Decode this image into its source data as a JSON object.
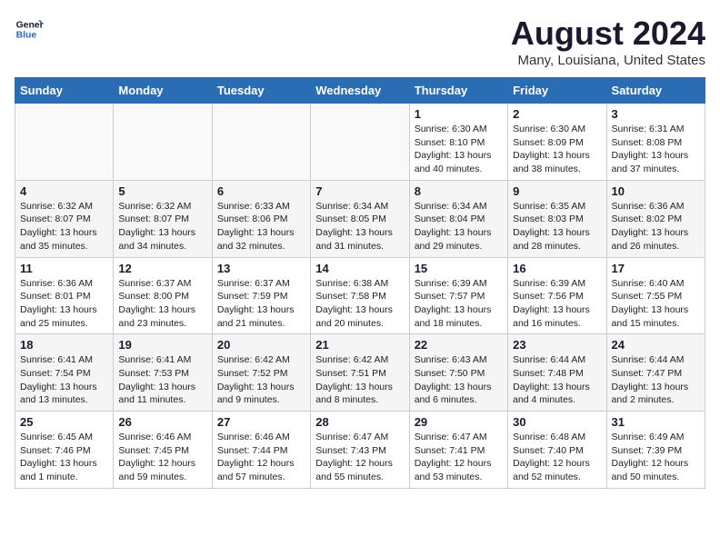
{
  "header": {
    "logo_line1": "General",
    "logo_line2": "Blue",
    "month": "August 2024",
    "location": "Many, Louisiana, United States"
  },
  "weekdays": [
    "Sunday",
    "Monday",
    "Tuesday",
    "Wednesday",
    "Thursday",
    "Friday",
    "Saturday"
  ],
  "weeks": [
    [
      {
        "day": "",
        "info": ""
      },
      {
        "day": "",
        "info": ""
      },
      {
        "day": "",
        "info": ""
      },
      {
        "day": "",
        "info": ""
      },
      {
        "day": "1",
        "info": "Sunrise: 6:30 AM\nSunset: 8:10 PM\nDaylight: 13 hours\nand 40 minutes."
      },
      {
        "day": "2",
        "info": "Sunrise: 6:30 AM\nSunset: 8:09 PM\nDaylight: 13 hours\nand 38 minutes."
      },
      {
        "day": "3",
        "info": "Sunrise: 6:31 AM\nSunset: 8:08 PM\nDaylight: 13 hours\nand 37 minutes."
      }
    ],
    [
      {
        "day": "4",
        "info": "Sunrise: 6:32 AM\nSunset: 8:07 PM\nDaylight: 13 hours\nand 35 minutes."
      },
      {
        "day": "5",
        "info": "Sunrise: 6:32 AM\nSunset: 8:07 PM\nDaylight: 13 hours\nand 34 minutes."
      },
      {
        "day": "6",
        "info": "Sunrise: 6:33 AM\nSunset: 8:06 PM\nDaylight: 13 hours\nand 32 minutes."
      },
      {
        "day": "7",
        "info": "Sunrise: 6:34 AM\nSunset: 8:05 PM\nDaylight: 13 hours\nand 31 minutes."
      },
      {
        "day": "8",
        "info": "Sunrise: 6:34 AM\nSunset: 8:04 PM\nDaylight: 13 hours\nand 29 minutes."
      },
      {
        "day": "9",
        "info": "Sunrise: 6:35 AM\nSunset: 8:03 PM\nDaylight: 13 hours\nand 28 minutes."
      },
      {
        "day": "10",
        "info": "Sunrise: 6:36 AM\nSunset: 8:02 PM\nDaylight: 13 hours\nand 26 minutes."
      }
    ],
    [
      {
        "day": "11",
        "info": "Sunrise: 6:36 AM\nSunset: 8:01 PM\nDaylight: 13 hours\nand 25 minutes."
      },
      {
        "day": "12",
        "info": "Sunrise: 6:37 AM\nSunset: 8:00 PM\nDaylight: 13 hours\nand 23 minutes."
      },
      {
        "day": "13",
        "info": "Sunrise: 6:37 AM\nSunset: 7:59 PM\nDaylight: 13 hours\nand 21 minutes."
      },
      {
        "day": "14",
        "info": "Sunrise: 6:38 AM\nSunset: 7:58 PM\nDaylight: 13 hours\nand 20 minutes."
      },
      {
        "day": "15",
        "info": "Sunrise: 6:39 AM\nSunset: 7:57 PM\nDaylight: 13 hours\nand 18 minutes."
      },
      {
        "day": "16",
        "info": "Sunrise: 6:39 AM\nSunset: 7:56 PM\nDaylight: 13 hours\nand 16 minutes."
      },
      {
        "day": "17",
        "info": "Sunrise: 6:40 AM\nSunset: 7:55 PM\nDaylight: 13 hours\nand 15 minutes."
      }
    ],
    [
      {
        "day": "18",
        "info": "Sunrise: 6:41 AM\nSunset: 7:54 PM\nDaylight: 13 hours\nand 13 minutes."
      },
      {
        "day": "19",
        "info": "Sunrise: 6:41 AM\nSunset: 7:53 PM\nDaylight: 13 hours\nand 11 minutes."
      },
      {
        "day": "20",
        "info": "Sunrise: 6:42 AM\nSunset: 7:52 PM\nDaylight: 13 hours\nand 9 minutes."
      },
      {
        "day": "21",
        "info": "Sunrise: 6:42 AM\nSunset: 7:51 PM\nDaylight: 13 hours\nand 8 minutes."
      },
      {
        "day": "22",
        "info": "Sunrise: 6:43 AM\nSunset: 7:50 PM\nDaylight: 13 hours\nand 6 minutes."
      },
      {
        "day": "23",
        "info": "Sunrise: 6:44 AM\nSunset: 7:48 PM\nDaylight: 13 hours\nand 4 minutes."
      },
      {
        "day": "24",
        "info": "Sunrise: 6:44 AM\nSunset: 7:47 PM\nDaylight: 13 hours\nand 2 minutes."
      }
    ],
    [
      {
        "day": "25",
        "info": "Sunrise: 6:45 AM\nSunset: 7:46 PM\nDaylight: 13 hours\nand 1 minute."
      },
      {
        "day": "26",
        "info": "Sunrise: 6:46 AM\nSunset: 7:45 PM\nDaylight: 12 hours\nand 59 minutes."
      },
      {
        "day": "27",
        "info": "Sunrise: 6:46 AM\nSunset: 7:44 PM\nDaylight: 12 hours\nand 57 minutes."
      },
      {
        "day": "28",
        "info": "Sunrise: 6:47 AM\nSunset: 7:43 PM\nDaylight: 12 hours\nand 55 minutes."
      },
      {
        "day": "29",
        "info": "Sunrise: 6:47 AM\nSunset: 7:41 PM\nDaylight: 12 hours\nand 53 minutes."
      },
      {
        "day": "30",
        "info": "Sunrise: 6:48 AM\nSunset: 7:40 PM\nDaylight: 12 hours\nand 52 minutes."
      },
      {
        "day": "31",
        "info": "Sunrise: 6:49 AM\nSunset: 7:39 PM\nDaylight: 12 hours\nand 50 minutes."
      }
    ]
  ]
}
